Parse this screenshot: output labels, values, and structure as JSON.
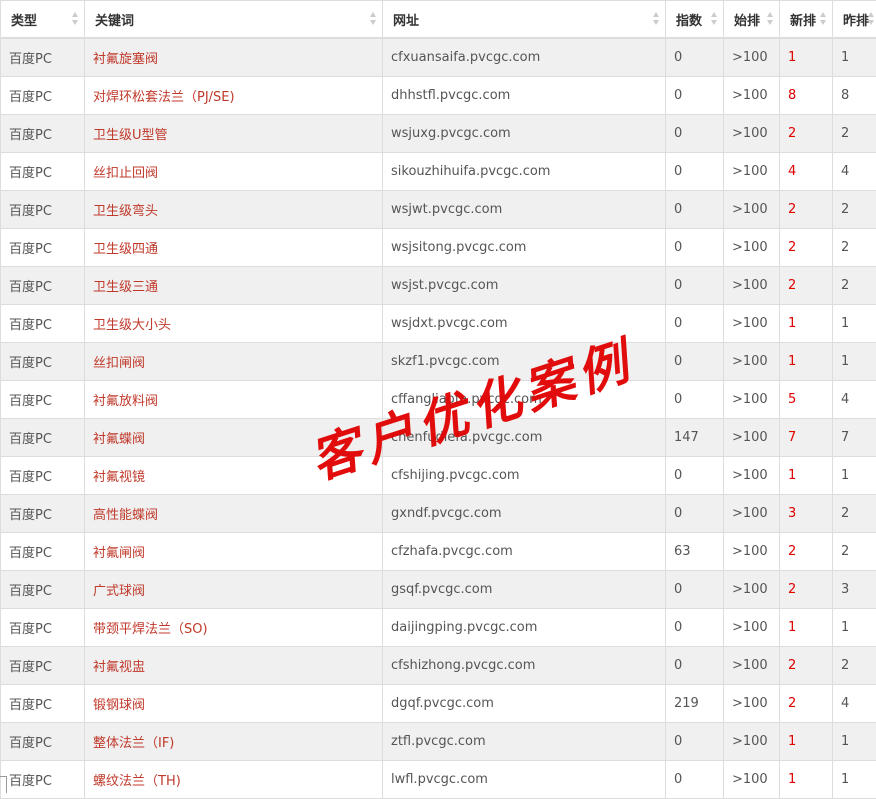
{
  "table": {
    "headers": {
      "type": "类型",
      "keyword": "关键词",
      "url": "网址",
      "index": "指数",
      "start_rank": "始排",
      "new_rank": "新排",
      "yesterday_rank": "昨排"
    },
    "rows": [
      {
        "type": "百度PC",
        "keyword": "衬氟旋塞阀",
        "url": "cfxuansaifa.pvcgc.com",
        "index": "0",
        "start": ">100",
        "new": "1",
        "yest": "1"
      },
      {
        "type": "百度PC",
        "keyword": "对焊环松套法兰（PJ/SE)",
        "url": "dhhstfl.pvcgc.com",
        "index": "0",
        "start": ">100",
        "new": "8",
        "yest": "8"
      },
      {
        "type": "百度PC",
        "keyword": "卫生级U型管",
        "url": "wsjuxg.pvcgc.com",
        "index": "0",
        "start": ">100",
        "new": "2",
        "yest": "2"
      },
      {
        "type": "百度PC",
        "keyword": "丝扣止回阀",
        "url": "sikouzhihuifa.pvcgc.com",
        "index": "0",
        "start": ">100",
        "new": "4",
        "yest": "4"
      },
      {
        "type": "百度PC",
        "keyword": "卫生级弯头",
        "url": "wsjwt.pvcgc.com",
        "index": "0",
        "start": ">100",
        "new": "2",
        "yest": "2"
      },
      {
        "type": "百度PC",
        "keyword": "卫生级四通",
        "url": "wsjsitong.pvcgc.com",
        "index": "0",
        "start": ">100",
        "new": "2",
        "yest": "2"
      },
      {
        "type": "百度PC",
        "keyword": "卫生级三通",
        "url": "wsjst.pvcgc.com",
        "index": "0",
        "start": ">100",
        "new": "2",
        "yest": "2"
      },
      {
        "type": "百度PC",
        "keyword": "卫生级大小头",
        "url": "wsjdxt.pvcgc.com",
        "index": "0",
        "start": ">100",
        "new": "1",
        "yest": "1"
      },
      {
        "type": "百度PC",
        "keyword": "丝扣闸阀",
        "url": "skzf1.pvcgc.com",
        "index": "0",
        "start": ">100",
        "new": "1",
        "yest": "1"
      },
      {
        "type": "百度PC",
        "keyword": "衬氟放料阀",
        "url": "cffangliaofa.pvcgc.com",
        "index": "0",
        "start": ">100",
        "new": "5",
        "yest": "4"
      },
      {
        "type": "百度PC",
        "keyword": "衬氟蝶阀",
        "url": "chenfudiefa.pvcgc.com",
        "index": "147",
        "start": ">100",
        "new": "7",
        "yest": "7"
      },
      {
        "type": "百度PC",
        "keyword": "衬氟视镜",
        "url": "cfshijing.pvcgc.com",
        "index": "0",
        "start": ">100",
        "new": "1",
        "yest": "1"
      },
      {
        "type": "百度PC",
        "keyword": "高性能蝶阀",
        "url": "gxndf.pvcgc.com",
        "index": "0",
        "start": ">100",
        "new": "3",
        "yest": "2"
      },
      {
        "type": "百度PC",
        "keyword": "衬氟闸阀",
        "url": "cfzhafa.pvcgc.com",
        "index": "63",
        "start": ">100",
        "new": "2",
        "yest": "2"
      },
      {
        "type": "百度PC",
        "keyword": "广式球阀",
        "url": "gsqf.pvcgc.com",
        "index": "0",
        "start": ">100",
        "new": "2",
        "yest": "3"
      },
      {
        "type": "百度PC",
        "keyword": "带颈平焊法兰（SO)",
        "url": "daijingping.pvcgc.com",
        "index": "0",
        "start": ">100",
        "new": "1",
        "yest": "1"
      },
      {
        "type": "百度PC",
        "keyword": "衬氟视盅",
        "url": "cfshizhong.pvcgc.com",
        "index": "0",
        "start": ">100",
        "new": "2",
        "yest": "2"
      },
      {
        "type": "百度PC",
        "keyword": "锻钢球阀",
        "url": "dgqf.pvcgc.com",
        "index": "219",
        "start": ">100",
        "new": "2",
        "yest": "4"
      },
      {
        "type": "百度PC",
        "keyword": "整体法兰（IF)",
        "url": "ztfl.pvcgc.com",
        "index": "0",
        "start": ">100",
        "new": "1",
        "yest": "1"
      },
      {
        "type": "百度PC",
        "keyword": "螺纹法兰（TH)",
        "url": "lwfl.pvcgc.com",
        "index": "0",
        "start": ">100",
        "new": "1",
        "yest": "1"
      }
    ]
  },
  "watermark": "客户优化案例",
  "colors": {
    "keyword_text": "#c0392b",
    "new_rank_text": "#e00000",
    "stripe": "#f0f0f0",
    "watermark": "#e10000"
  },
  "icons": {
    "sort": "sort-arrows-icon"
  }
}
